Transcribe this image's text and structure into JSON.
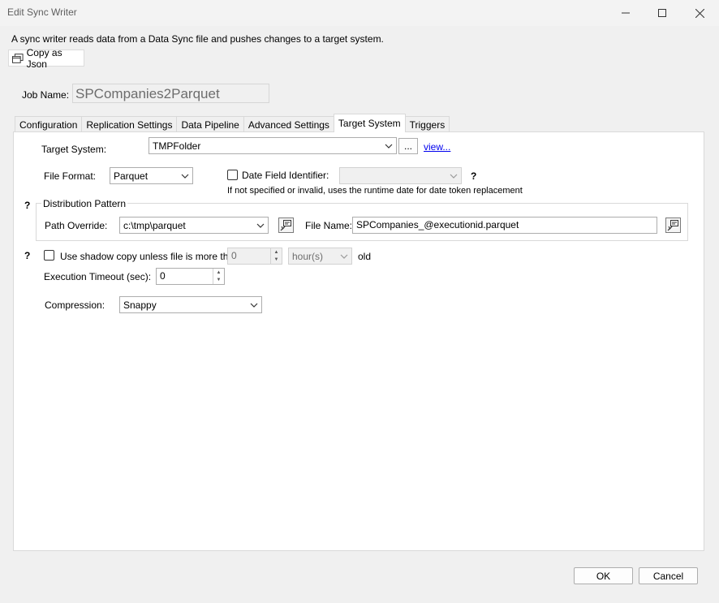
{
  "window": {
    "title": "Edit Sync Writer",
    "minimize_icon": "minimize-icon",
    "maximize_icon": "maximize-icon",
    "close_icon": "close-icon"
  },
  "description": "A sync writer reads data from a Data Sync file and pushes changes to a target system.",
  "copy_button": {
    "label": "Copy as Json",
    "icon": "copy-icon"
  },
  "job": {
    "label": "Job Name:",
    "value": "SPCompanies2Parquet"
  },
  "tabs": [
    {
      "label": "Configuration",
      "active": false
    },
    {
      "label": "Replication Settings",
      "active": false
    },
    {
      "label": "Data Pipeline",
      "active": false
    },
    {
      "label": "Advanced Settings",
      "active": false
    },
    {
      "label": "Target System",
      "active": true
    },
    {
      "label": "Triggers",
      "active": false
    }
  ],
  "target_system": {
    "label": "Target System:",
    "value": "TMPFolder",
    "browse_label": "...",
    "view_link": "view..."
  },
  "file_format": {
    "label": "File Format:",
    "value": "Parquet"
  },
  "date_field": {
    "label": "Date Field Identifier:",
    "checked": false,
    "value": "",
    "help": "?",
    "note": "If not specified or invalid, uses the runtime date for date token replacement"
  },
  "distribution": {
    "help": "?",
    "label": "Distribution Pattern",
    "path_label": "Path Override:",
    "path_value": "c:\\tmp\\parquet",
    "file_name_label": "File Name:",
    "file_name_value": "SPCompanies_@executionid.parquet"
  },
  "shadow_copy": {
    "help": "?",
    "label": "Use shadow copy unless file is more than",
    "checked": false,
    "amount": "0",
    "unit": "hour(s)",
    "suffix": "old"
  },
  "timeout": {
    "label": "Execution Timeout (sec):",
    "value": "0"
  },
  "compression": {
    "label": "Compression:",
    "value": "Snappy"
  },
  "buttons": {
    "ok": "OK",
    "cancel": "Cancel"
  }
}
